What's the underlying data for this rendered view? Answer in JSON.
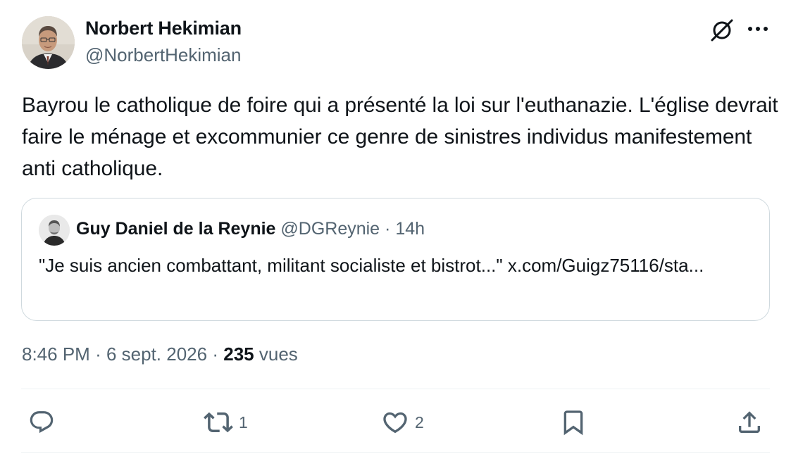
{
  "author": {
    "name": "Norbert Hekimian",
    "handle": "@NorbertHekimian"
  },
  "tweet_text": "Bayrou le catholique de foire qui a présenté la loi sur l'euthanazie. L'église devrait faire le ménage et excommunier ce genre de sinistres individus manifestement anti catholique.",
  "quoted": {
    "name": "Guy Daniel de la Reynie",
    "handle": "@DGReynie",
    "separator": "·",
    "age": "14h",
    "text": "\"Je suis ancien combattant, militant socialiste et bistrot...\" x.com/Guigz75116/sta..."
  },
  "meta": {
    "time": "8:46 PM",
    "separator": "·",
    "date": "6 sept. 2026",
    "views": "235",
    "views_label": "vues"
  },
  "actions": {
    "reply_icon": "reply-icon",
    "retweet_icon": "retweet-icon",
    "retweet_count": "1",
    "like_icon": "heart-icon",
    "like_count": "2",
    "bookmark_icon": "bookmark-icon",
    "share_icon": "share-icon"
  },
  "header_icons": [
    "grok-icon",
    "more-icon"
  ],
  "colors": {
    "text": "#0f1419",
    "secondary": "#536471",
    "border": "#cfd9de",
    "divider": "#eff3f4"
  }
}
